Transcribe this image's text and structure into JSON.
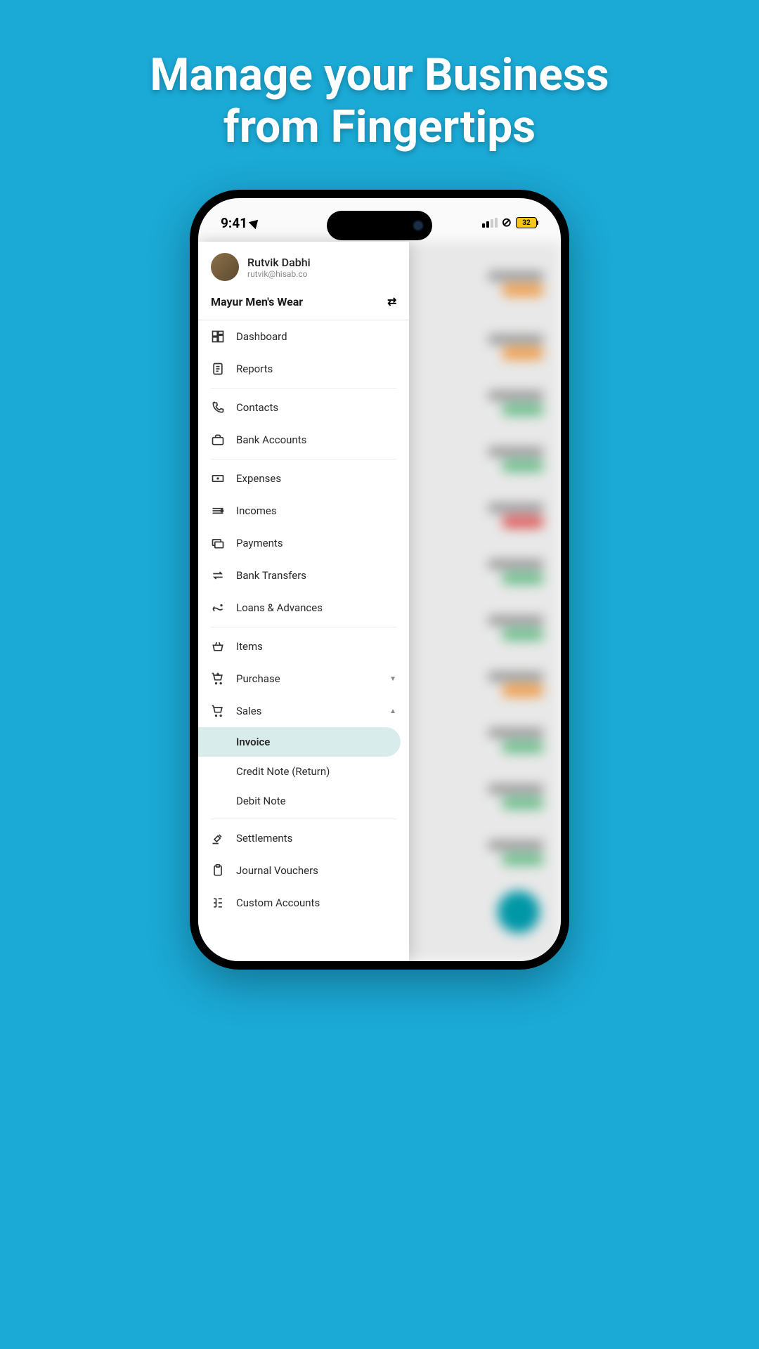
{
  "hero": {
    "line1": "Manage your Business",
    "line2": "from Fingertips"
  },
  "status": {
    "time": "9:41",
    "battery": "32"
  },
  "user": {
    "name": "Rutvik Dabhi",
    "email": "rutvik@hisab.co"
  },
  "business": {
    "name": "Mayur Men's Wear"
  },
  "menu": {
    "dashboard": "Dashboard",
    "reports": "Reports",
    "contacts": "Contacts",
    "bank_accounts": "Bank Accounts",
    "expenses": "Expenses",
    "incomes": "Incomes",
    "payments": "Payments",
    "bank_transfers": "Bank Transfers",
    "loans_advances": "Loans & Advances",
    "items": "Items",
    "purchase": "Purchase",
    "sales": "Sales",
    "sales_invoice": "Invoice",
    "sales_credit_note": "Credit Note (Return)",
    "sales_debit_note": "Debit Note",
    "settlements": "Settlements",
    "journal_vouchers": "Journal Vouchers",
    "custom_accounts": "Custom Accounts"
  }
}
